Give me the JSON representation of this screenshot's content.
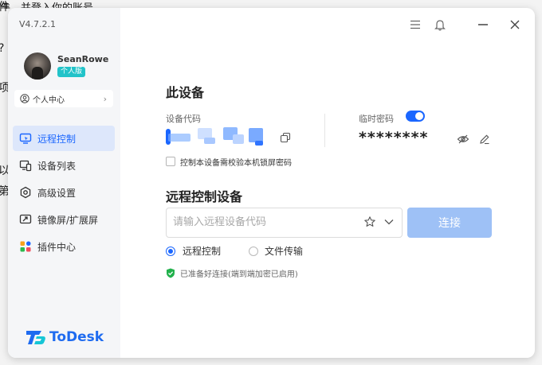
{
  "background_doc": {
    "top_line": "件，并登入你的账号",
    "side_chars": [
      "件",
      "?",
      "项",
      "以",
      "第"
    ]
  },
  "app": {
    "version": "V4.7.2.1",
    "accent_color": "#1a66ff",
    "brand": "ToDesk"
  },
  "user": {
    "name": "SeanRowe",
    "plan": "个人版",
    "personal_center": "个人中心"
  },
  "nav": {
    "items": [
      {
        "label": "远程控制",
        "icon": "monitor-cursor-icon",
        "active": true
      },
      {
        "label": "设备列表",
        "icon": "devices-icon",
        "active": false
      },
      {
        "label": "高级设置",
        "icon": "settings-hex-icon",
        "active": false
      },
      {
        "label": "镜像屏/扩展屏",
        "icon": "mirror-screen-icon",
        "active": false
      },
      {
        "label": "插件中心",
        "icon": "plugins-icon",
        "active": false
      }
    ]
  },
  "topbar": {
    "icons": [
      "menu-icon",
      "bell-icon",
      "minimize-icon",
      "close-icon"
    ]
  },
  "device": {
    "title": "此设备",
    "code_label": "设备代码",
    "temp_password_label": "临时密码",
    "temp_password_enabled": true,
    "password_mask": "********",
    "lock_screen_check_label": "控制本设备需校验本机锁屏密码",
    "lock_screen_checked": false
  },
  "remote": {
    "title": "远程控制设备",
    "input_placeholder": "请输入远程设备代码",
    "input_value": "",
    "connect_label": "连接",
    "modes": [
      {
        "label": "远程控制",
        "selected": true
      },
      {
        "label": "文件传输",
        "selected": false
      }
    ],
    "status": "已准备好连接(端到端加密已启用)"
  }
}
